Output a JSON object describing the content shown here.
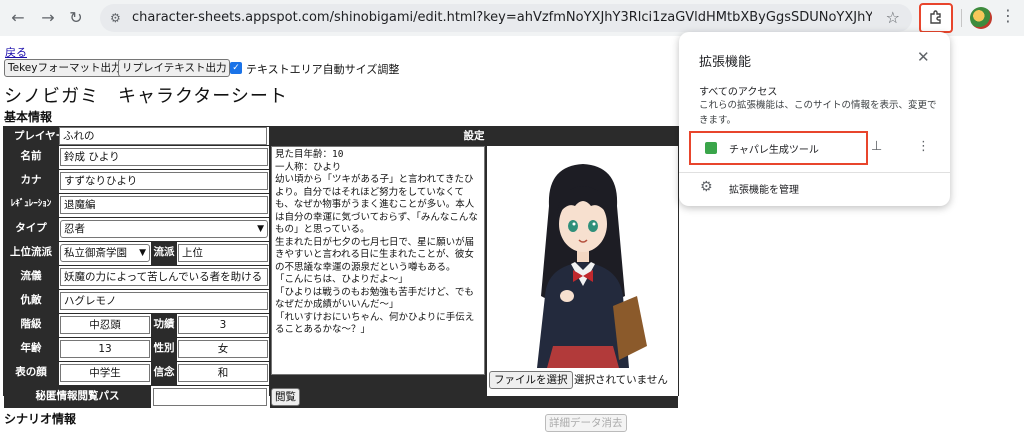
{
  "browser": {
    "url": "character-sheets.appspot.com/shinobigami/edit.html?key=ahVzfmNoYXJhY3Rlci1zaGVldHMtbXByGgsSDUNoYXJhY3RlckRhdGEYgI..."
  },
  "page": {
    "back_link": "戻る",
    "btn_tekey": "Tekeyフォーマット出力",
    "btn_replay": "リプレイテキスト出力",
    "auto_resize_label": "テキストエリア自動サイズ調整",
    "title": "シノビガミ　キャラクターシート",
    "section_basic": "基本情報",
    "section_scenario": "シナリオ情報"
  },
  "sheet": {
    "player_label": "プレイヤー",
    "player": "ふれの",
    "name_label": "名前",
    "name": "鈴成 ひより",
    "kana_label": "カナ",
    "kana": "すずなりひより",
    "regulation_label": "ﾚｷﾞｭﾚｰｼｮﾝ",
    "regulation": "退魔編",
    "type_label": "タイプ",
    "type": "忍者",
    "upper_school_label": "上位流派",
    "upper_school": "私立御斎学園",
    "school_label": "流派",
    "school": "上位",
    "belief_label": "流儀",
    "belief": "妖魔の力によって苦しんでいる者を助ける",
    "enemy_label": "仇敵",
    "enemy": "ハグレモノ",
    "rank_label": "階級",
    "rank": "中忍頭",
    "merit_label": "功績",
    "merit": "3",
    "age_label": "年齢",
    "age": "13",
    "gender_label": "性別",
    "gender": "女",
    "face_label": "表の顔",
    "face": "中学生",
    "creed_label": "信念",
    "creed": "和",
    "secret_label": "秘匿情報閲覧パス",
    "secret": "",
    "view_button": "閲覧",
    "settings_label": "設定",
    "settings_lines": [
      "見た目年齢：10",
      "一人称：ひより",
      "",
      "幼い頃から「ツキがある子」と言われてきたひより。自分ではそれほど努力をしていなくても、なぜか物事がうまく進むことが多い。本人は自分の幸運に気づいておらず、「みんなこんなもの」と思っている。",
      "",
      "生まれた日が七夕の七月七日で、星に願いが届きやすいと言われる日に生まれたことが、彼女の不思議な幸運の源泉だという噂もある。",
      "",
      "「こんにちは、ひよりだよ～」",
      "「ひよりは戦うのもお勉強も苦手だけど、でもなぜだか成績がいいんだ～」",
      "「れいすけおにいちゃん、何かひよりに手伝えることあるかな～？」"
    ],
    "file_button": "ファイルを選択",
    "file_status": "選択されていません",
    "delete_button": "詳細データ消去"
  },
  "extensions_popup": {
    "title": "拡張機能",
    "subtitle": "すべてのアクセス",
    "description": "これらの拡張機能は、このサイトの情報を表示、変更できます。",
    "extension_name": "チャパレ生成ツール",
    "manage": "拡張機能を管理"
  },
  "colors": {
    "highlight": "#e8452c",
    "header_bg": "#2b2b2b",
    "checkbox": "#1a73e8"
  }
}
